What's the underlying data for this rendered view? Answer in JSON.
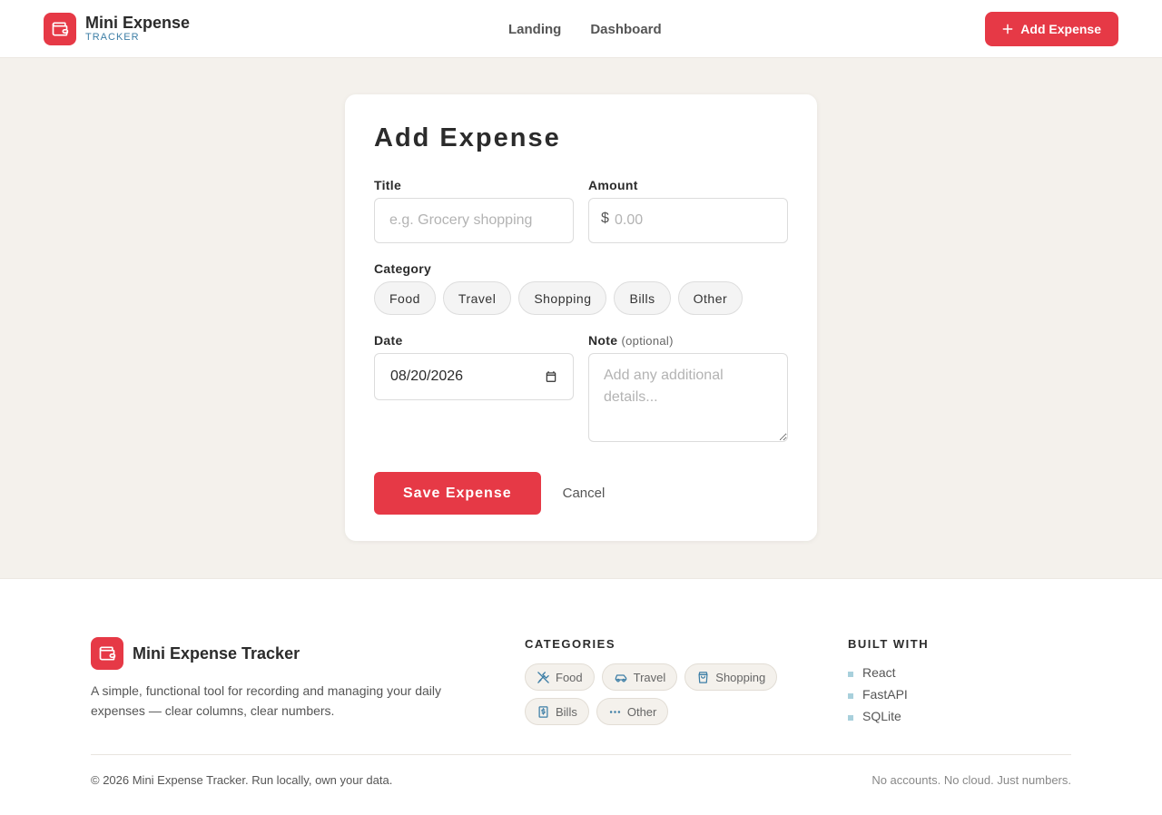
{
  "header": {
    "brand_name": "Mini Expense",
    "brand_sub": "TRACKER",
    "nav": [
      {
        "label": "Landing"
      },
      {
        "label": "Dashboard"
      }
    ],
    "add_button": "Add Expense",
    "brand_color": "#e63946"
  },
  "form": {
    "title": "Add Expense",
    "title_label": "Title",
    "title_placeholder": "e.g. Grocery shopping",
    "amount_label": "Amount",
    "currency_symbol": "$",
    "amount_placeholder": "0.00",
    "category_label": "Category",
    "categories": [
      "Food",
      "Travel",
      "Shopping",
      "Bills",
      "Other"
    ],
    "date_label": "Date",
    "date_value": "08/20/2026",
    "note_label": "Note",
    "note_optional": "(optional)",
    "note_placeholder": "Add any additional details...",
    "save_button": "Save Expense",
    "cancel_button": "Cancel"
  },
  "footer": {
    "brand_name": "Mini Expense Tracker",
    "description": "A simple, functional tool for recording and managing your daily expenses — clear columns, clear numbers.",
    "categories_heading": "CATEGORIES",
    "categories": [
      {
        "label": "Food",
        "icon": "utensils-icon"
      },
      {
        "label": "Travel",
        "icon": "car-icon"
      },
      {
        "label": "Shopping",
        "icon": "shopping-bag-icon"
      },
      {
        "label": "Bills",
        "icon": "receipt-icon"
      },
      {
        "label": "Other",
        "icon": "more-icon"
      }
    ],
    "built_heading": "BUILT WITH",
    "built_with": [
      "React",
      "FastAPI",
      "SQLite"
    ],
    "copyright": "© 2026 Mini Expense Tracker. Run locally, own your data.",
    "tagline": "No accounts. No cloud. Just numbers."
  }
}
